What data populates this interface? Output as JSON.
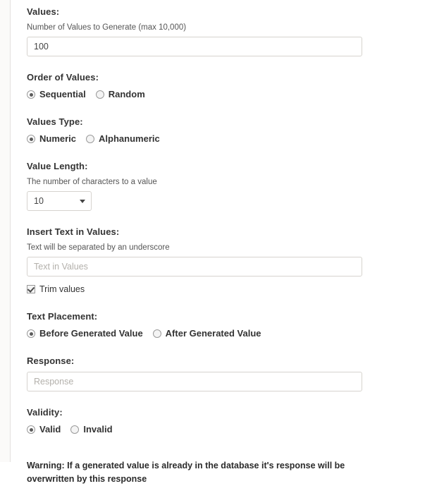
{
  "form": {
    "values_section": {
      "label": "Values:",
      "helper": "Number of Values to Generate (max 10,000)",
      "input_value": "100",
      "input_placeholder": ""
    },
    "order_section": {
      "label": "Order of Values:",
      "options": [
        {
          "label": "Sequential",
          "selected": true
        },
        {
          "label": "Random",
          "selected": false
        }
      ]
    },
    "values_type_section": {
      "label": "Values Type:",
      "options": [
        {
          "label": "Numeric",
          "selected": true
        },
        {
          "label": "Alphanumeric",
          "selected": false
        }
      ]
    },
    "value_length_section": {
      "label": "Value Length:",
      "helper": "The number of characters to a value",
      "selected_value": "10",
      "options": [
        "10"
      ],
      "dropdown_icon": "chevron-down-icon"
    },
    "insert_text_section": {
      "label": "Insert Text in Values:",
      "helper": "Text will be separated by an underscore",
      "input_value": "",
      "input_placeholder": "Text in Values",
      "trim_checkbox": {
        "label": "Trim values",
        "checked": true
      }
    },
    "text_placement_section": {
      "label": "Text Placement:",
      "options": [
        {
          "label": "Before Generated Value",
          "selected": true
        },
        {
          "label": "After Generated Value",
          "selected": false
        }
      ]
    },
    "response_section": {
      "label": "Response:",
      "input_value": "",
      "input_placeholder": "Response"
    },
    "validity_section": {
      "label": "Validity:",
      "options": [
        {
          "label": "Valid",
          "selected": true
        },
        {
          "label": "Invalid",
          "selected": false
        }
      ]
    },
    "warning": "Warning: If a generated value is already in the database it's response will be overwritten by this response"
  },
  "colors": {
    "text": "#333333",
    "helper_text": "#555555",
    "placeholder": "#b3b0ab",
    "border": "#d6d3ce",
    "gutter_bg": "#fbfaf9",
    "page_bg": "#ffffff"
  }
}
